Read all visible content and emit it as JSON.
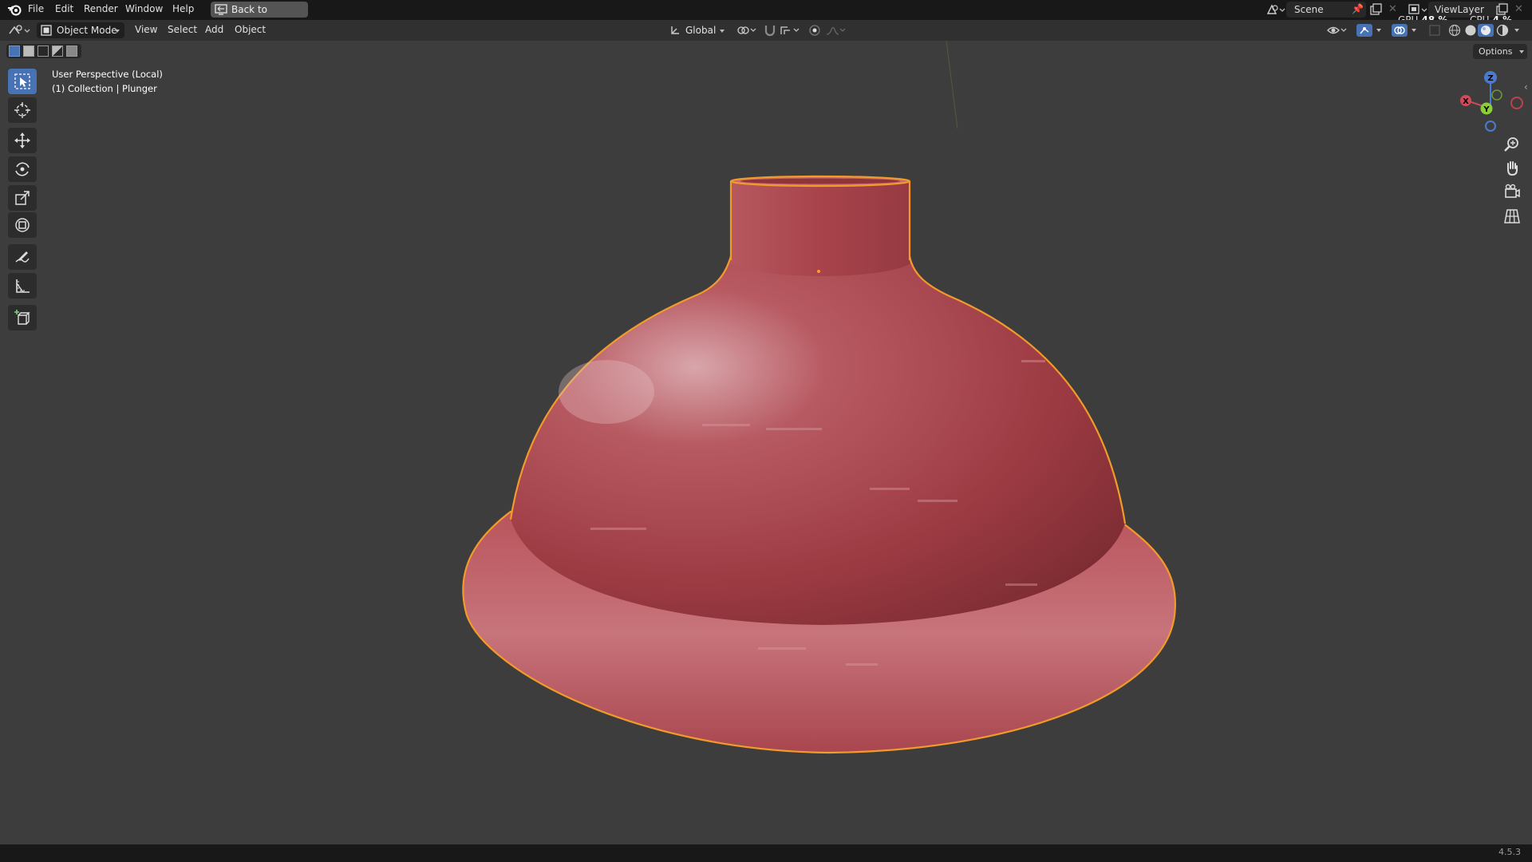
{
  "menu": {
    "file": "File",
    "edit": "Edit",
    "render": "Render",
    "window": "Window",
    "help": "Help",
    "back_to_previous": "Back to Previous",
    "scene": "Scene",
    "view_layer": "ViewLayer"
  },
  "stats": {
    "gpu_label": "GPU",
    "gpu_value": "48 %",
    "cpu_label": "CPU",
    "cpu_value": "4 %"
  },
  "header": {
    "mode": "Object Mode",
    "view": "View",
    "select": "Select",
    "add": "Add",
    "object": "Object",
    "orientation": "Global",
    "options": "Options"
  },
  "viewport": {
    "perspective": "User Perspective (Local)",
    "collection": "(1) Collection | Plunger",
    "object_color": "#b24a52",
    "selection_outline_color": "#f29a2a"
  },
  "gizmo": {
    "x": "X",
    "y": "Y",
    "z": "Z"
  },
  "tools": [
    "select-box",
    "cursor",
    "move",
    "rotate",
    "scale",
    "transform",
    "annotate",
    "measure",
    "add-cube"
  ],
  "status": {
    "version": "4.5.3"
  },
  "colors": {
    "active_tool": "#4772b3",
    "background": "#3d3d3d"
  }
}
